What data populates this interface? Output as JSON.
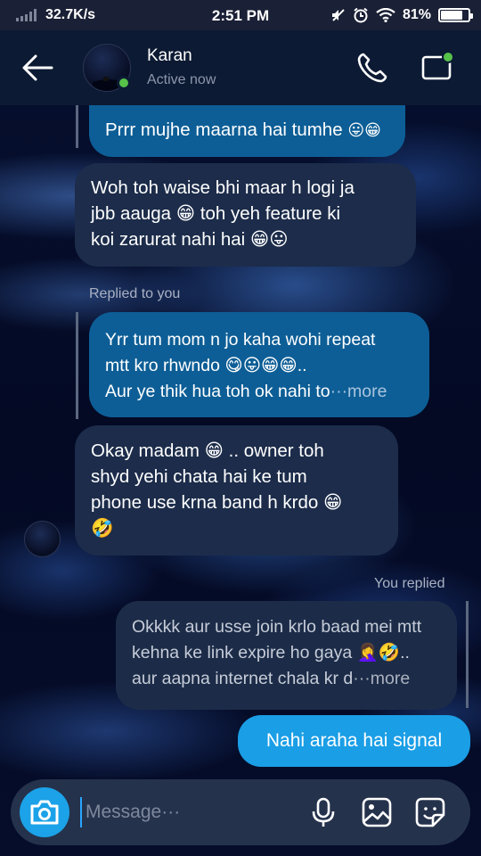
{
  "status_bar": {
    "speed": "32.7K/s",
    "time": "2:51 PM",
    "battery": "81%",
    "battery_level": 0.81
  },
  "header": {
    "contact_name": "Karan",
    "contact_status": "Active now",
    "icons": [
      "back-arrow-icon",
      "phone-icon",
      "video-call-icon"
    ]
  },
  "messages": [
    {
      "type": "quoted",
      "text": "Prrr mujhe maarna hai tumhe",
      "emoji": "😛😁"
    },
    {
      "type": "received",
      "lines": [
        "Woh toh waise bhi maar h logi ja",
        "jbb aauga 😁 toh yeh feature ki",
        "koi zarurat nahi hai 😁😛"
      ]
    },
    {
      "type": "reply_label",
      "text": "Replied to you"
    },
    {
      "type": "quoted",
      "lines": [
        "Yrr tum mom n jo kaha wohi repeat",
        "mtt kro rhwndo 😋😛😁😁..",
        "Aur ye thik hua toh ok nahi to"
      ],
      "more": "···more"
    },
    {
      "type": "received",
      "lines": [
        "Okay madam 😁 .. owner toh",
        "shyd yehi chata hai ke tum",
        "phone use krna band h krdo 😁",
        "🤣"
      ]
    },
    {
      "type": "reply_label",
      "text": "You replied"
    },
    {
      "type": "quoted",
      "lines": [
        "Okkkk aur usse join krlo baad mei mtt",
        "kehna ke link expire ho gaya 🤦‍♀️🤣..",
        "aur aapna internet chala kr d"
      ],
      "more": "···more"
    },
    {
      "type": "sent",
      "text": "Nahi araha hai signal"
    }
  ],
  "composer": {
    "placeholder": "Message···",
    "value": "",
    "icons": [
      "camera-icon",
      "microphone-icon",
      "gallery-icon",
      "sticker-icon"
    ]
  },
  "colors": {
    "header_bg": "#0c1a33",
    "received_bubble": "#1c2c4a",
    "quoted_bubble": "#0d5e96",
    "sent_bubble": "#1a9ee6",
    "online": "#56c24a"
  }
}
